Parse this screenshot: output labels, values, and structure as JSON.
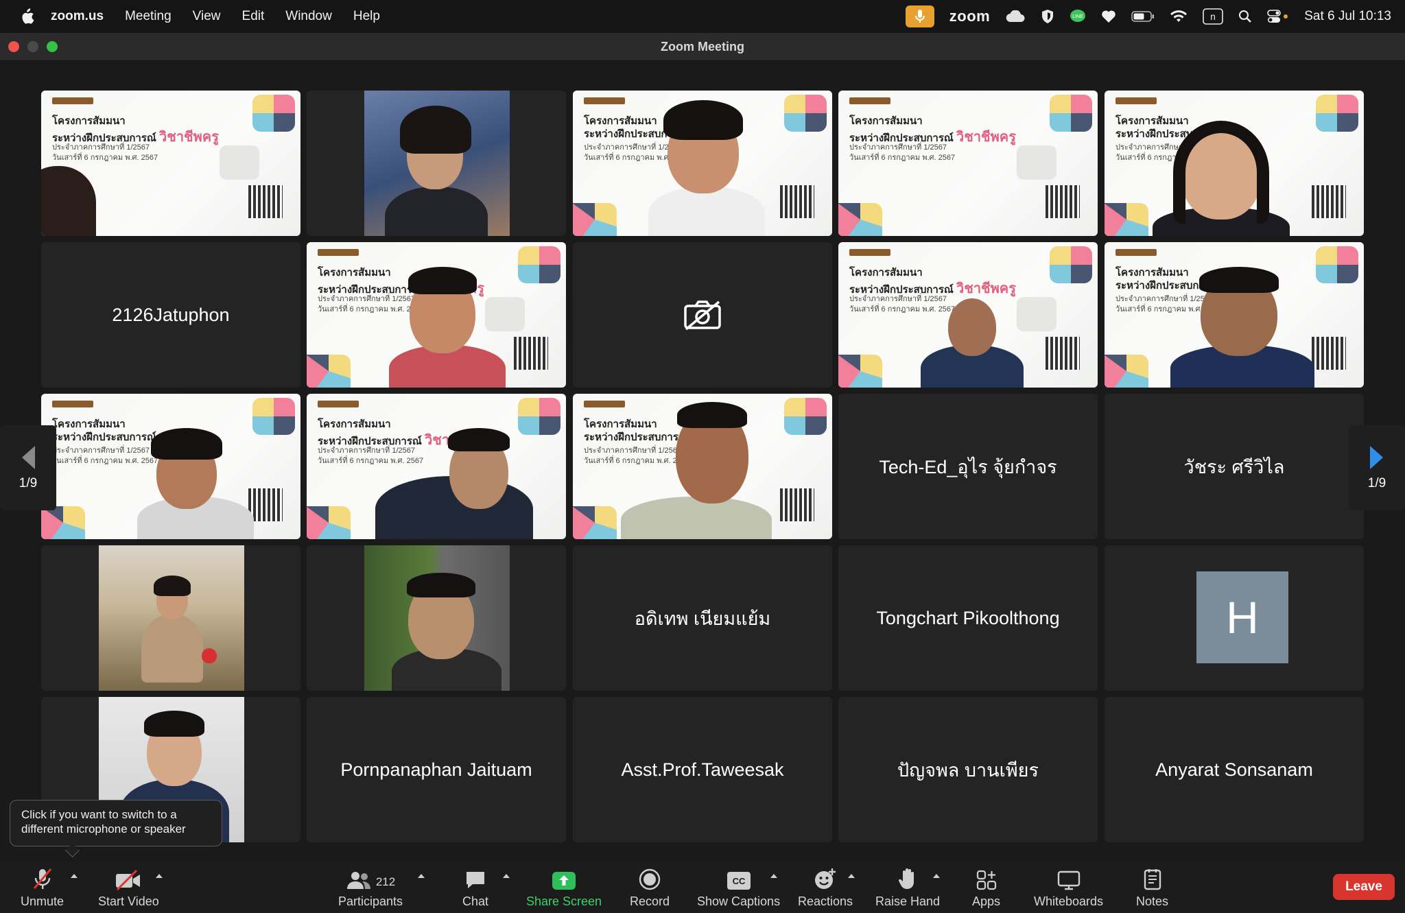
{
  "menubar": {
    "app": "zoom.us",
    "items": [
      "Meeting",
      "View",
      "Edit",
      "Window",
      "Help"
    ],
    "zoom_label": "zoom",
    "clock": "Sat 6 Jul  10:13"
  },
  "window": {
    "title": "Zoom Meeting"
  },
  "slide": {
    "line1": "โครงการสัมมนา",
    "line2": "ระหว่างฝึกประสบการณ์",
    "line2_accent": "วิชาชีพครู",
    "line3": "ประจำภาคการศึกษาที่ 1/2567",
    "line4": "วันเสาร์ที่ 6 กรกฎาคม พ.ศ. 2567"
  },
  "participants": {
    "tile_2126": "2126Jatuphon",
    "tile_teched": "Tech-Ed_อุไร จุ้ยกำจร",
    "tile_watchara": "วัชระ ศรีวิไล",
    "tile_adithep": "อดิเทพ เนียมแย้ม",
    "tile_tongchart": "Tongchart Pikoolthong",
    "tile_h_initial": "H",
    "tile_pornpanaphan": "Pornpanaphan Jaituam",
    "tile_taweesak": "Asst.Prof.Taweesak",
    "tile_panyaphon": "ปัญจพล บานเพียร",
    "tile_anyarat": "Anyarat Sonsanam"
  },
  "pager": {
    "left": "1/9",
    "right": "1/9"
  },
  "tooltip": {
    "text": "Click if you want to switch to a different microphone or speaker"
  },
  "toolbar": {
    "unmute": "Unmute",
    "start_video": "Start Video",
    "participants_count": "212",
    "participants": "Participants",
    "chat": "Chat",
    "share_screen": "Share Screen",
    "record": "Record",
    "show_captions": "Show Captions",
    "reactions": "Reactions",
    "raise_hand": "Raise Hand",
    "apps": "Apps",
    "whiteboards": "Whiteboards",
    "notes": "Notes",
    "leave": "Leave"
  },
  "colors": {
    "active_speaker": "#3fb950",
    "share_green": "#3fd06a",
    "leave_red": "#d9352f",
    "mic_pill": "#e8a030",
    "pager_arrow": "#2f8fe8"
  }
}
